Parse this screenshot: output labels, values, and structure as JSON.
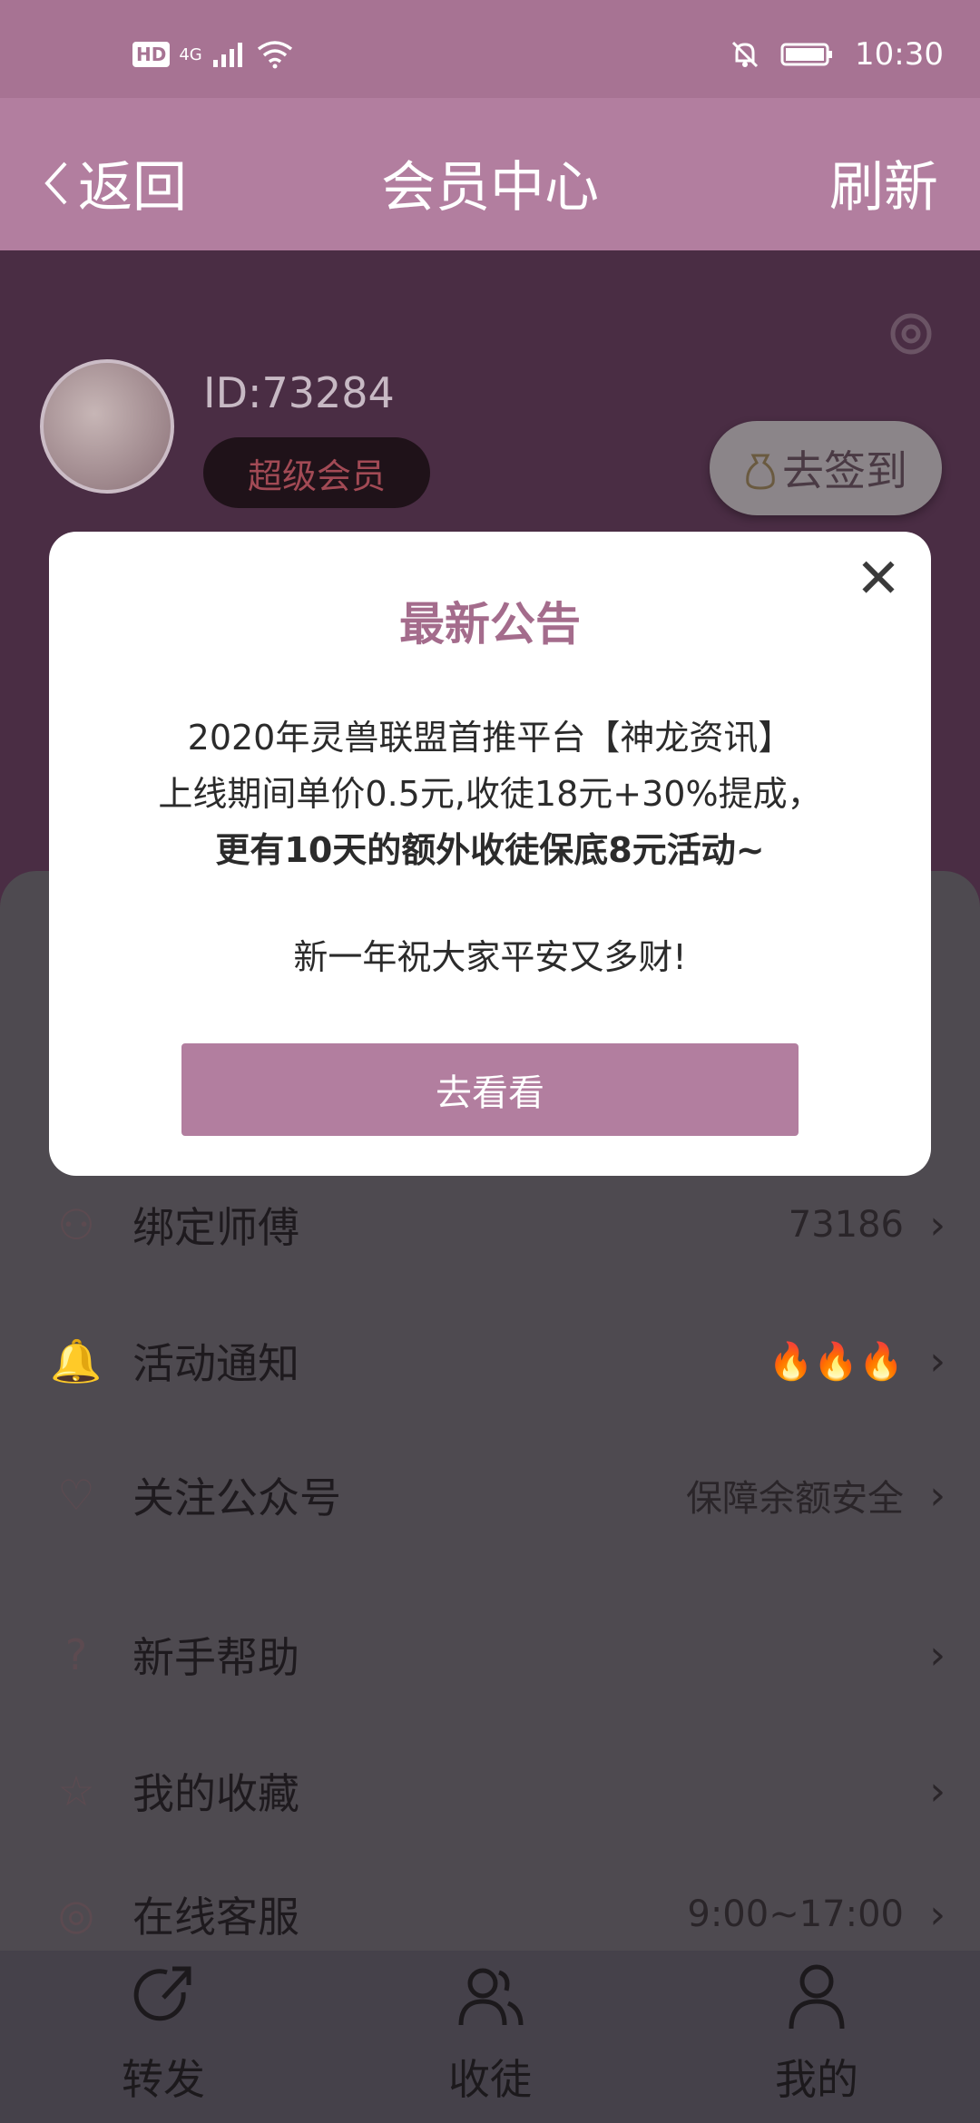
{
  "status_bar": {
    "hd": "HD",
    "network": "4G",
    "time": "10:30"
  },
  "nav": {
    "back_label": "返回",
    "title": "会员中心",
    "refresh_label": "刷新"
  },
  "profile": {
    "user_id": "ID:73284",
    "vip_badge": "超级会员",
    "sign_in_label": "去签到"
  },
  "menu": {
    "items": [
      {
        "label": "绑定师傅",
        "value": "73186",
        "icon": "bind-icon"
      },
      {
        "label": "活动通知",
        "value": "🔥🔥🔥",
        "icon": "bell-icon"
      },
      {
        "label": "关注公众号",
        "value": "保障余额安全",
        "icon": "heart-plus-icon"
      },
      {
        "label": "新手帮助",
        "value": "",
        "icon": "help-icon"
      },
      {
        "label": "我的收藏",
        "value": "",
        "icon": "star-icon"
      },
      {
        "label": "在线客服",
        "value": "9:00~17:00",
        "icon": "headset-icon"
      }
    ]
  },
  "tabbar": {
    "tabs": [
      {
        "label": "转发"
      },
      {
        "label": "收徒"
      },
      {
        "label": "我的"
      }
    ]
  },
  "modal": {
    "title": "最新公告",
    "line1": "2020年灵兽联盟首推平台【神龙资讯】",
    "line2": "上线期间单价0.5元,收徒18元+30%提成，",
    "line3": "更有10天的额外收徒保底8元活动~",
    "greeting": "新一年祝大家平安又多财!",
    "button_label": "去看看"
  },
  "colors": {
    "accent": "#b27e9f",
    "title_accent": "#a46c8c",
    "status_bar": "#a77393"
  }
}
